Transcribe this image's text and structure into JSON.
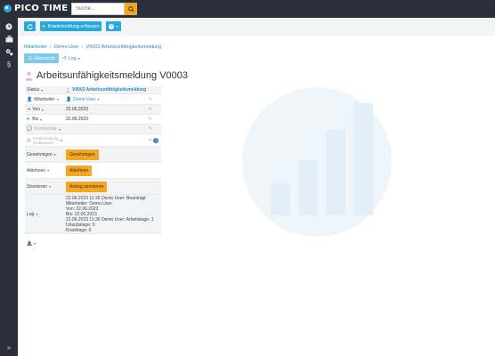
{
  "app": {
    "logo_text": "PICO TIME",
    "brand_color": "#29a8e0",
    "accent": "#f5a623"
  },
  "search": {
    "placeholder": "Suche..."
  },
  "sidebar": {
    "items": [
      {
        "icon": "clock-icon"
      },
      {
        "icon": "briefcase-icon"
      },
      {
        "icon": "cogs-icon"
      },
      {
        "icon": "paragraph-icon"
      }
    ],
    "expand_icon": "double-chevron-right-icon"
  },
  "toolbar": {
    "create_label": "Krankmeldung erfassen",
    "help_label": "?"
  },
  "breadcrumb": [
    "Mitarbeiter",
    "Demo User",
    "V0003 Arbeitsunfähigkeitsmeldung"
  ],
  "tabs": {
    "overview": "Übersicht",
    "log": "Log"
  },
  "title": "Arbeitsunfähigkeitsmeldung V0003",
  "details": {
    "status_label": "Status",
    "status_value": "V0003 Arbeitsunfähigkeitsmeldung",
    "employee_label": "Mitarbeiter",
    "employee_value": "Demo User",
    "from_label": "Von",
    "from_value": "22.06.2023",
    "to_label": "Bis",
    "to_value": "22.06.2023",
    "comment_label": "Kommentar",
    "doc_label_1": "Krankmeldung",
    "doc_label_2": "(Dokument)",
    "approve_label": "Genehmigen",
    "approve_button": "Genehmigen",
    "reject_label": "Ablehnen",
    "reject_button": "Ablehnen",
    "cancel_label": "Stornieren",
    "cancel_button": "Antrag stornieren",
    "log_label": "Log",
    "log_lines": [
      "22.06.2023 11:36 Demo User: Beantragt",
      "Mitarbeiter: Demo User",
      "Von: 22.06.2023",
      "Bis: 22.06.2023",
      "22.06.2023 11:36 Demo User: Arbeitstage: 1",
      "Urlaubstage: 0",
      "Kranktage: 0"
    ]
  }
}
